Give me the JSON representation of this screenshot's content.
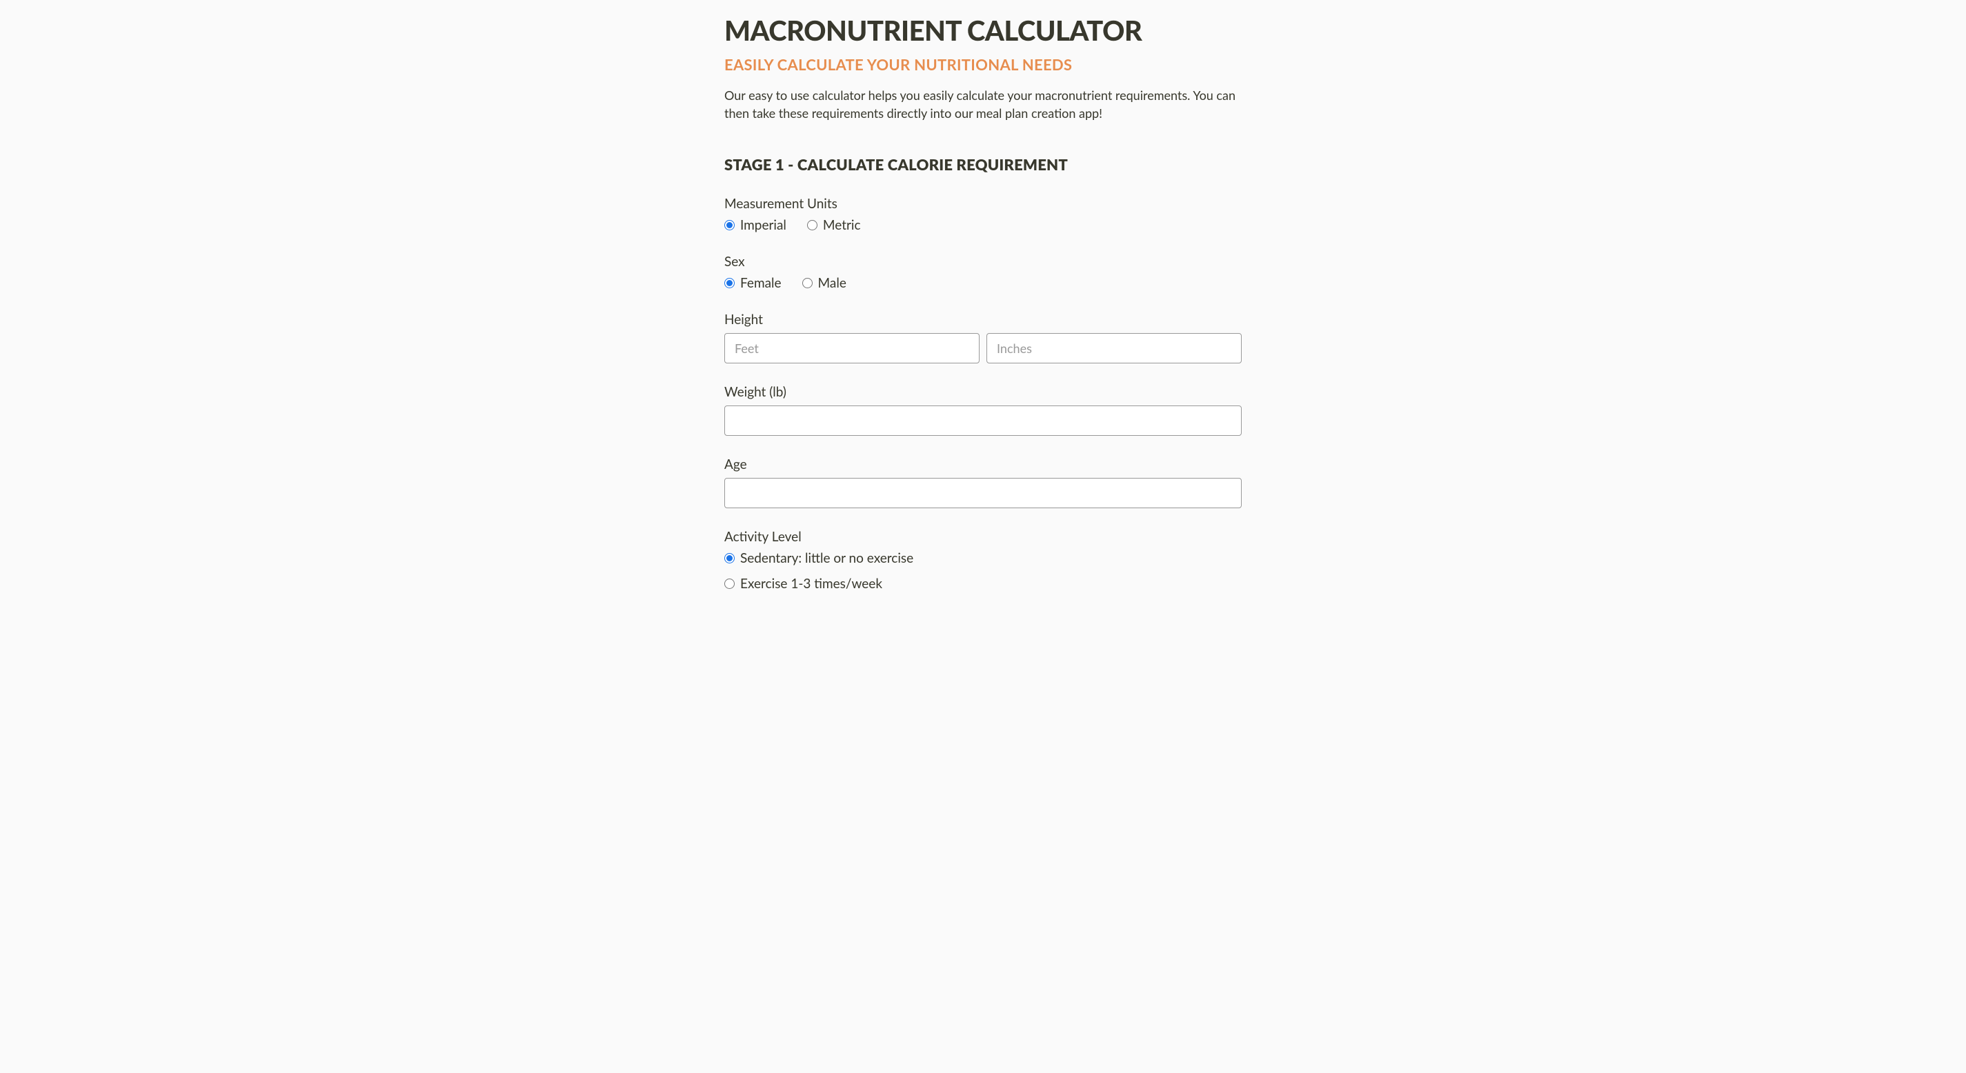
{
  "header": {
    "title": "MACRONUTRIENT CALCULATOR",
    "subtitle": "EASILY CALCULATE YOUR NUTRITIONAL NEEDS",
    "intro": "Our easy to use calculator helps you easily calculate your macronutrient requirements. You can then take these requirements directly into our meal plan creation app!"
  },
  "stage1": {
    "heading": "STAGE 1 - CALCULATE CALORIE REQUIREMENT",
    "units": {
      "label": "Measurement Units",
      "options": {
        "imperial": "Imperial",
        "metric": "Metric"
      }
    },
    "sex": {
      "label": "Sex",
      "options": {
        "female": "Female",
        "male": "Male"
      }
    },
    "height": {
      "label": "Height",
      "feet_placeholder": "Feet",
      "inches_placeholder": "Inches"
    },
    "weight": {
      "label": "Weight (lb)"
    },
    "age": {
      "label": "Age"
    },
    "activity": {
      "label": "Activity Level",
      "options": {
        "sedentary": "Sedentary: little or no exercise",
        "light": "Exercise 1-3 times/week"
      }
    }
  }
}
